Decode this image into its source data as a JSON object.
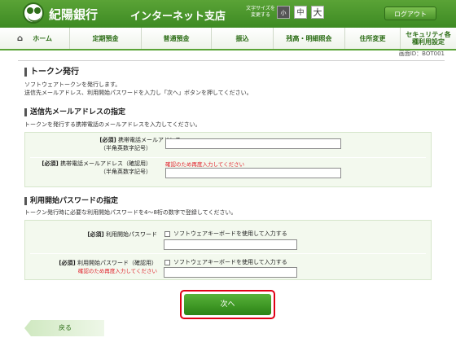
{
  "header": {
    "bank_name": "紀陽銀行",
    "branch_name": "インターネット支店",
    "font_size_label": "文字サイズを変更する",
    "font_sizes": [
      "小",
      "中",
      "大"
    ],
    "logout": "ログアウト"
  },
  "nav": {
    "home": "ホーム",
    "items": [
      "定期預金",
      "普通預金",
      "振込",
      "残高・明細照会",
      "住所変更",
      "セキュリティ各種利用設定"
    ]
  },
  "screen_id": "画面ID：BOT001",
  "page": {
    "title": "トークン発行",
    "desc1": "ソフトウェアトークンを発行します。",
    "desc2": "送信先メールアドレス、利用開始パスワードを入力し「次へ」ボタンを押してください。"
  },
  "email_section": {
    "title": "送信先メールアドレスの指定",
    "desc": "トークンを発行する携帯電話のメールアドレスを入力してください。",
    "required": "[必須]",
    "email_label": "携帯電話メールアドレス",
    "email_sub": "（半角英数字記号）",
    "confirm_label": "携帯電話メールアドレス（確認用）",
    "confirm_sub": "（半角英数字記号）",
    "confirm_note": "確認のため再度入力してください",
    "email_value": "",
    "confirm_value": ""
  },
  "password_section": {
    "title": "利用開始パスワードの指定",
    "desc": "トークン発行時に必要な利用開始パスワードを4～8桁の数字で登録してください。",
    "required": "[必須]",
    "pw_label": "利用開始パスワード",
    "pw_confirm_label": "利用開始パスワード（確認用）",
    "pw_confirm_note": "確認のため再度入力してください",
    "keyboard_option": "ソフトウェアキーボードを使用して入力する",
    "pw_value": "",
    "pw_confirm_value": ""
  },
  "buttons": {
    "next": "次へ",
    "back": "戻る"
  },
  "colors": {
    "brand_green": "#3d8a23",
    "alert_red": "#e0202a",
    "highlight_red": "#e00015"
  }
}
